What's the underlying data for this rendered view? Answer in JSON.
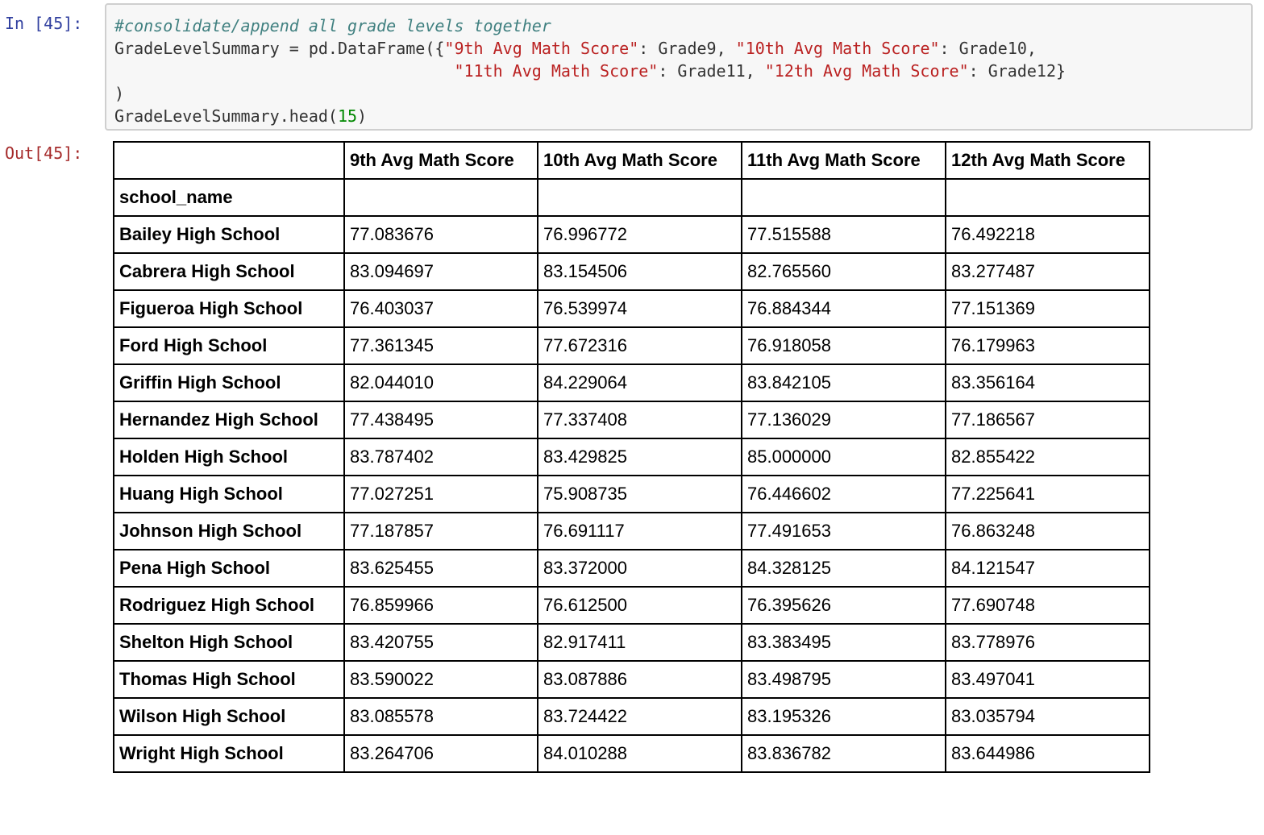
{
  "input_prompt": "In [45]:",
  "output_prompt": "Out[45]:",
  "code": {
    "comment": "#consolidate/append all grade levels together",
    "line2_a": "GradeLevelSummary ",
    "line2_eq": "=",
    "line2_b": " pd.DataFrame({",
    "line2_s1": "\"9th Avg Math Score\"",
    "line2_c1": ": Grade9, ",
    "line2_s2": "\"10th Avg Math Score\"",
    "line2_c2": ": Grade10,",
    "line3_indent": "                                   ",
    "line3_s3": "\"11th Avg Math Score\"",
    "line3_c3": ": Grade11, ",
    "line3_s4": "\"12th Avg Math Score\"",
    "line3_c4": ": Grade12}",
    "line4": ")",
    "line5_a": "GradeLevelSummary.head(",
    "line5_num": "15",
    "line5_b": ")"
  },
  "table": {
    "columns": [
      "",
      "9th Avg Math Score",
      "10th Avg Math Score",
      "11th Avg Math Score",
      "12th Avg Math Score"
    ],
    "index_name": "school_name",
    "rows": [
      {
        "school": "Bailey High School",
        "v": [
          "77.083676",
          "76.996772",
          "77.515588",
          "76.492218"
        ]
      },
      {
        "school": "Cabrera High School",
        "v": [
          "83.094697",
          "83.154506",
          "82.765560",
          "83.277487"
        ]
      },
      {
        "school": "Figueroa High School",
        "v": [
          "76.403037",
          "76.539974",
          "76.884344",
          "77.151369"
        ]
      },
      {
        "school": "Ford High School",
        "v": [
          "77.361345",
          "77.672316",
          "76.918058",
          "76.179963"
        ]
      },
      {
        "school": "Griffin High School",
        "v": [
          "82.044010",
          "84.229064",
          "83.842105",
          "83.356164"
        ]
      },
      {
        "school": "Hernandez High School",
        "v": [
          "77.438495",
          "77.337408",
          "77.136029",
          "77.186567"
        ]
      },
      {
        "school": "Holden High School",
        "v": [
          "83.787402",
          "83.429825",
          "85.000000",
          "82.855422"
        ]
      },
      {
        "school": "Huang High School",
        "v": [
          "77.027251",
          "75.908735",
          "76.446602",
          "77.225641"
        ]
      },
      {
        "school": "Johnson High School",
        "v": [
          "77.187857",
          "76.691117",
          "77.491653",
          "76.863248"
        ]
      },
      {
        "school": "Pena High School",
        "v": [
          "83.625455",
          "83.372000",
          "84.328125",
          "84.121547"
        ]
      },
      {
        "school": "Rodriguez High School",
        "v": [
          "76.859966",
          "76.612500",
          "76.395626",
          "77.690748"
        ]
      },
      {
        "school": "Shelton High School",
        "v": [
          "83.420755",
          "82.917411",
          "83.383495",
          "83.778976"
        ]
      },
      {
        "school": "Thomas High School",
        "v": [
          "83.590022",
          "83.087886",
          "83.498795",
          "83.497041"
        ]
      },
      {
        "school": "Wilson High School",
        "v": [
          "83.085578",
          "83.724422",
          "83.195326",
          "83.035794"
        ]
      },
      {
        "school": "Wright High School",
        "v": [
          "83.264706",
          "84.010288",
          "83.836782",
          "83.644986"
        ]
      }
    ]
  },
  "colors": {
    "input_prompt": "#303f9f",
    "output_prompt": "#a52a2a",
    "comment": "#408080",
    "string": "#ba2121",
    "number": "#008800",
    "cell_background": "#f7f7f7"
  }
}
